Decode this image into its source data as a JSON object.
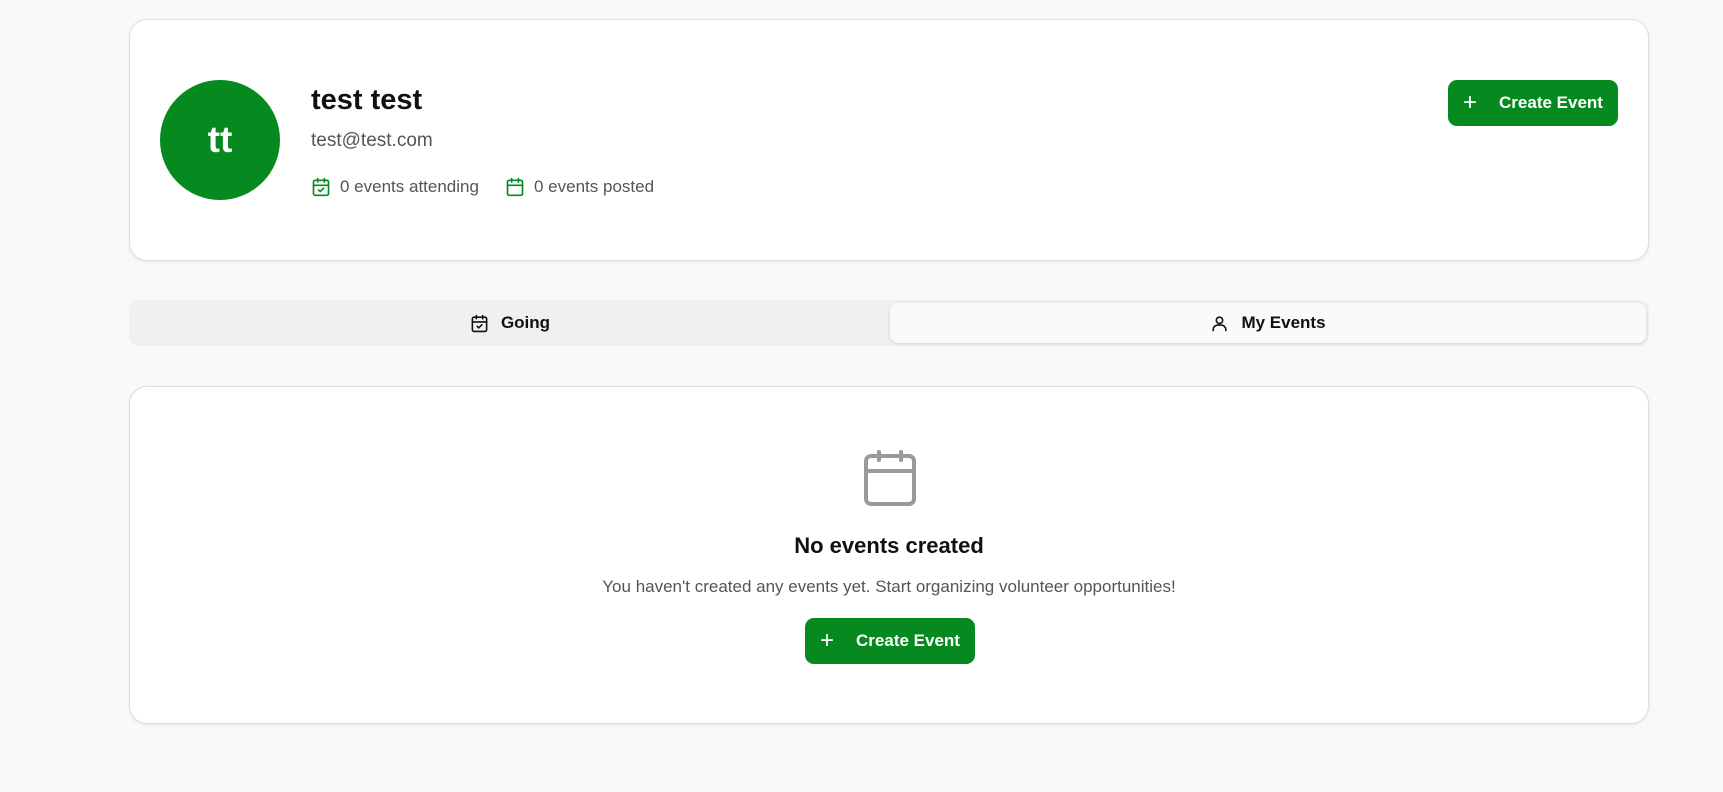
{
  "colors": {
    "primary": "#068a20",
    "text": "#111111",
    "muted": "#555555",
    "icon_gray": "#9a9a9a"
  },
  "profile": {
    "initials": "tt",
    "name": "test test",
    "email": "test@test.com",
    "stats": {
      "attending": "0 events attending",
      "posted": "0 events posted"
    },
    "create_button": {
      "icon": "plus-icon",
      "label": "Create Event"
    }
  },
  "tabs": [
    {
      "icon": "calendar-check-icon",
      "label": "Going",
      "active": false
    },
    {
      "icon": "user-icon",
      "label": "My Events",
      "active": true
    }
  ],
  "empty_state": {
    "icon": "calendar-icon",
    "title": "No events created",
    "description": "You haven't created any events yet. Start organizing volunteer opportunities!",
    "create_button": {
      "icon": "plus-icon",
      "label": "Create Event"
    }
  }
}
